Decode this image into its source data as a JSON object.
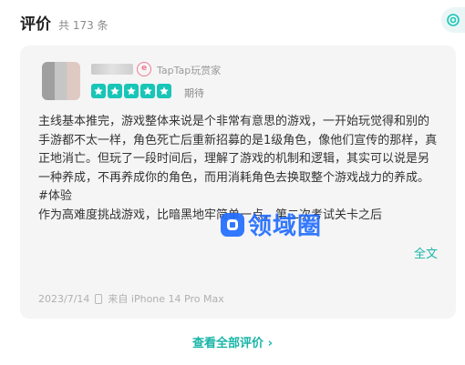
{
  "header": {
    "title": "评价",
    "count": "共 173 条"
  },
  "review": {
    "badge": "TapTap玩赏家",
    "rating_label": "期待",
    "stars": 5,
    "paragraphs": [
      "主线基本推完，游戏整体来说是个非常有意思的游戏，一开始玩觉得和别的手游都不太一样，角色死亡后重新招募的是1级角色，像他们宣传的那样，真正地消亡。但玩了一段时间后，理解了游戏的机制和逻辑，其实可以说是另一种养成，不再养成你的角色，而用消耗角色去换取整个游戏战力的养成。",
      "#体验",
      "作为高难度挑战游戏，比暗黑地牢简单一点，第二次考试关卡之后"
    ],
    "expand_label": "全文",
    "date": "2023/7/14",
    "device": "来自 iPhone 14 Pro Max"
  },
  "watermark": {
    "text": "领域圈"
  },
  "footer": {
    "view_all": "查看全部评价 ›"
  },
  "colors": {
    "accent": "#19c5b7",
    "link": "#19b5a8",
    "card_bg": "#f5f5f6"
  }
}
